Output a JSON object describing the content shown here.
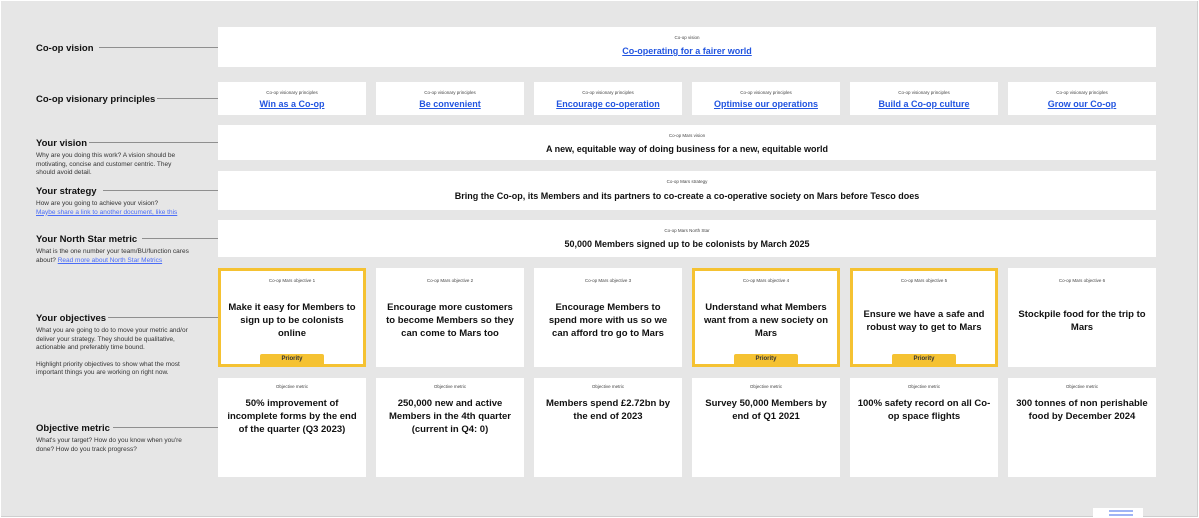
{
  "labels": {
    "vision": {
      "title": "Co-op vision"
    },
    "principles": {
      "title": "Co-op visionary principles"
    },
    "your_vision": {
      "title": "Your vision",
      "desc": "Why are you doing this work? A vision should be motivating, concise and customer centric. They should avoid detail."
    },
    "your_strategy": {
      "title": "Your strategy",
      "desc": "How are you going to achieve your vision?",
      "link": "Maybe share a link to another document, like this"
    },
    "north_star": {
      "title": "Your North Star metric",
      "desc": "What is the one number your team/BU/function cares about?",
      "link": "Read more about North Star Metrics"
    },
    "objectives": {
      "title": "Your objectives",
      "desc": "What you are going to do to move your metric and/or deliver your strategy. They should be qualitative, actionable and preferably time bound.",
      "desc2": "Highlight priority objectives to show what the most important things you are working on right now."
    },
    "metric": {
      "title": "Objective metric",
      "desc": "What's your target? How do you know when you're done? How do you track progress?"
    }
  },
  "vision_card": {
    "small": "Co-op vision",
    "text": "Co-operating for a fairer world"
  },
  "principles": [
    {
      "small": "Co-op visionary principles",
      "text": "Win as a Co-op"
    },
    {
      "small": "Co-op visionary principles",
      "text": "Be convenient"
    },
    {
      "small": "Co-op visionary principles",
      "text": "Encourage co-operation"
    },
    {
      "small": "Co-op visionary principles",
      "text": "Optimise our operations"
    },
    {
      "small": "Co-op visionary principles",
      "text": "Build a Co-op culture"
    },
    {
      "small": "Co-op visionary principles",
      "text": "Grow our Co-op"
    }
  ],
  "mars_vision": {
    "small": "Co-op Mars vision",
    "text": "A new, equitable way of doing business for a new, equitable world"
  },
  "mars_strategy": {
    "small": "Co-op Mars strategy",
    "text": "Bring the Co-op, its Members and its partners to co-create a co-operative society on Mars before Tesco does"
  },
  "north_star_card": {
    "small": "Co-op Mars North Star",
    "text": "50,000 Members signed up to be colonists by March 2025"
  },
  "priority_label": "Priority",
  "objectives": [
    {
      "small": "Co-op Mars objective 1",
      "text": "Make it easy for Members to sign up to be colonists online",
      "priority": true
    },
    {
      "small": "Co-op Mars objective 2",
      "text": "Encourage more customers to become Members so they can come to Mars too",
      "priority": false
    },
    {
      "small": "Co-op Mars objective 3",
      "text": "Encourage Members to spend more with us so we can afford tro go to Mars",
      "priority": false
    },
    {
      "small": "Co-op Mars objective 4",
      "text": "Understand what Members want from a new society on Mars",
      "priority": true
    },
    {
      "small": "Co-op Mars objective 5",
      "text": "Ensure we have a safe and robust way to get to Mars",
      "priority": true
    },
    {
      "small": "Co-op Mars objective 6",
      "text": "Stockpile food for the trip to Mars",
      "priority": false
    }
  ],
  "metrics": [
    {
      "small": "Objective metric",
      "text": "50% improvement of incomplete forms by the end of the quarter (Q3 2023)"
    },
    {
      "small": "Objective metric",
      "text": "250,000 new and active Members in the 4th quarter (current in Q4: 0)"
    },
    {
      "small": "Objective metric",
      "text": "Members spend £2.72bn by the end of 2023"
    },
    {
      "small": "Objective metric",
      "text": "Survey 50,000 Members by end of Q1 2021"
    },
    {
      "small": "Objective metric",
      "text": "100% safety record on all Co-op space flights"
    },
    {
      "small": "Objective metric",
      "text": "300 tonnes of non perishable food by December 2024"
    }
  ],
  "colors": {
    "priority": "#f5c232",
    "link": "#2255e0",
    "board": "#e6e6e6"
  }
}
